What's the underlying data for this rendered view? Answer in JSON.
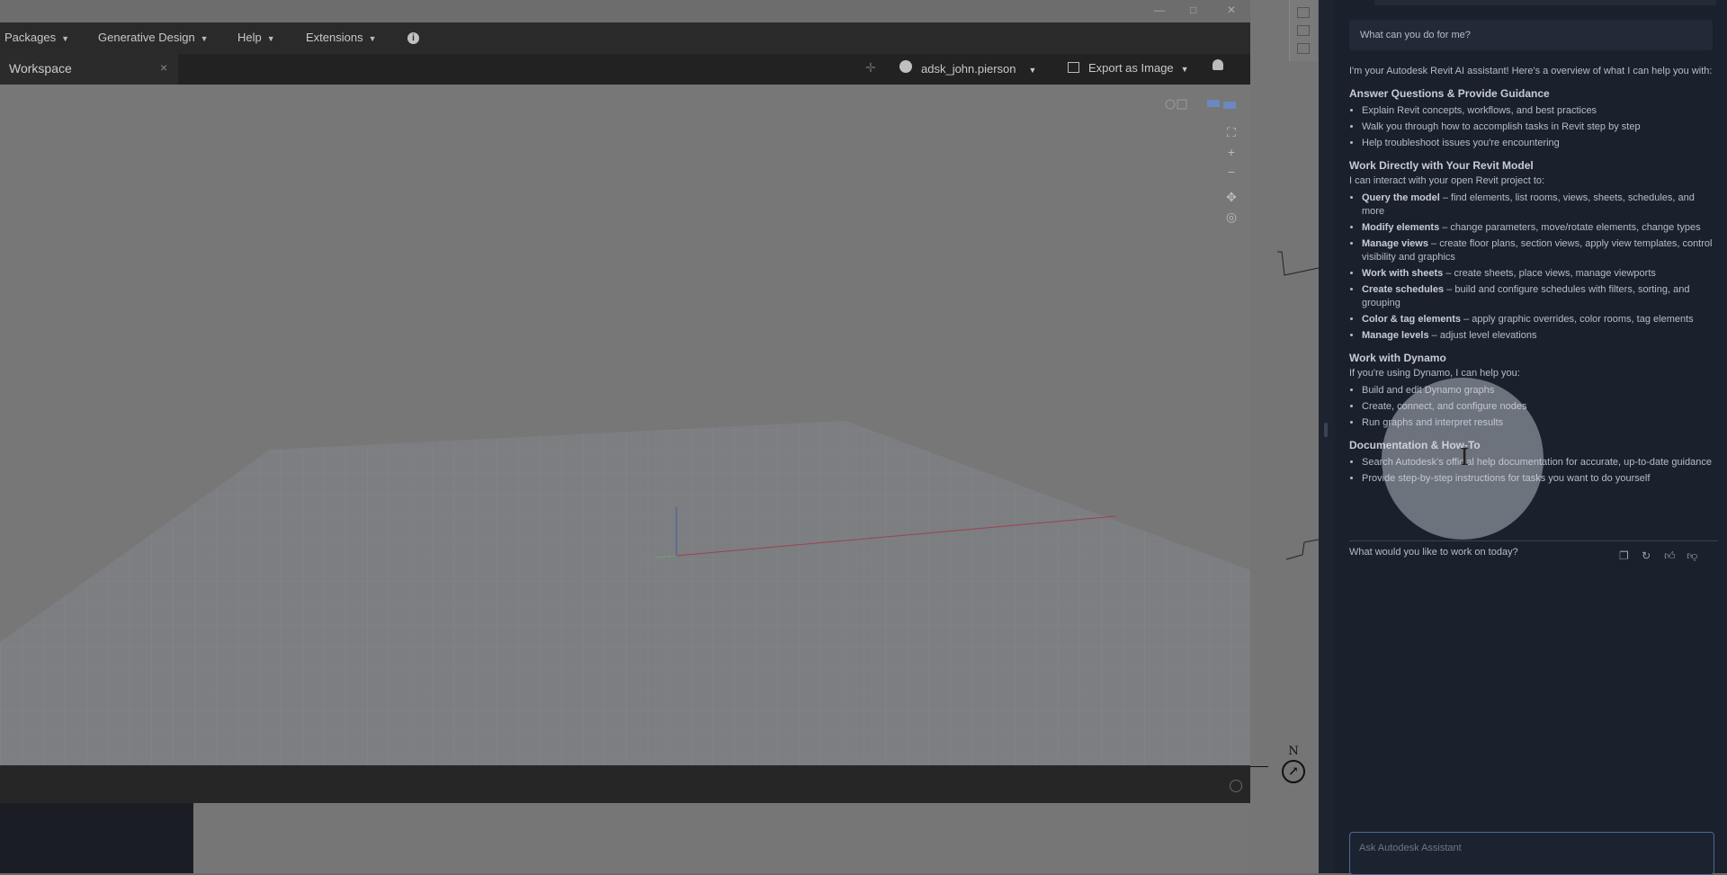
{
  "dynamo": {
    "menu": [
      {
        "label": "Packages"
      },
      {
        "label": "Generative Design"
      },
      {
        "label": "Help"
      },
      {
        "label": "Extensions"
      }
    ],
    "tab_label": "Workspace",
    "tab_close": "×",
    "user_name": "adsk_john.pierson",
    "export_label": "Export as Image",
    "window_controls": {
      "minimize": "—",
      "maximize": "□",
      "close": "✕"
    },
    "nav": {
      "zoom_extents": "⛶",
      "zoom_in": "+",
      "zoom_out": "−",
      "pan": "✥",
      "orbit": "◎"
    }
  },
  "revit": {
    "compass_label": "N",
    "compass_glyph": "↗"
  },
  "assistant": {
    "user_message": "What can you do for me?",
    "intro": "I'm your Autodesk Revit AI assistant! Here's a overview of what I can help you with:",
    "sections": [
      {
        "heading": "Answer Questions & Provide Guidance",
        "items": [
          {
            "text": "Explain Revit concepts, workflows, and best practices"
          },
          {
            "text": "Walk you through how to accomplish tasks in Revit step by step"
          },
          {
            "text": "Help troubleshoot issues you're encountering"
          }
        ]
      },
      {
        "heading": "Work Directly with Your Revit Model",
        "lead": "I can interact with your open Revit project to:",
        "items": [
          {
            "bold": "Query the model",
            "text": " – find elements, list rooms, views, sheets, schedules, and more"
          },
          {
            "bold": "Modify elements",
            "text": " – change parameters, move/rotate elements, change types"
          },
          {
            "bold": "Manage views",
            "text": " – create floor plans, section views, apply view templates, control visibility and graphics"
          },
          {
            "bold": "Work with sheets",
            "text": " – create sheets, place views, manage viewports"
          },
          {
            "bold": "Create schedules",
            "text": " – build and configure schedules with filters, sorting, and grouping"
          },
          {
            "bold": "Color & tag elements",
            "text": " – apply graphic overrides, color rooms, tag elements"
          },
          {
            "bold": "Manage levels",
            "text": " – adjust level elevations"
          }
        ]
      },
      {
        "heading": "Work with Dynamo",
        "lead": "If you're using Dynamo, I can help you:",
        "items": [
          {
            "text": "Build and edit Dynamo graphs"
          },
          {
            "text": "Create, connect, and configure nodes"
          },
          {
            "text": "Run graphs and interpret results"
          }
        ]
      },
      {
        "heading": "Documentation & How-To",
        "items": [
          {
            "text": "Search Autodesk's official help documentation for accurate, up-to-date guidance"
          },
          {
            "text": "Provide step-by-step instructions for tasks you want to do yourself"
          }
        ]
      }
    ],
    "follow_up": "What would you like to work on today?",
    "input_placeholder": "Ask Autodesk Assistant",
    "action_icons": [
      "copy-icon",
      "refresh-icon",
      "thumbs-up-icon",
      "thumbs-down-icon"
    ]
  }
}
